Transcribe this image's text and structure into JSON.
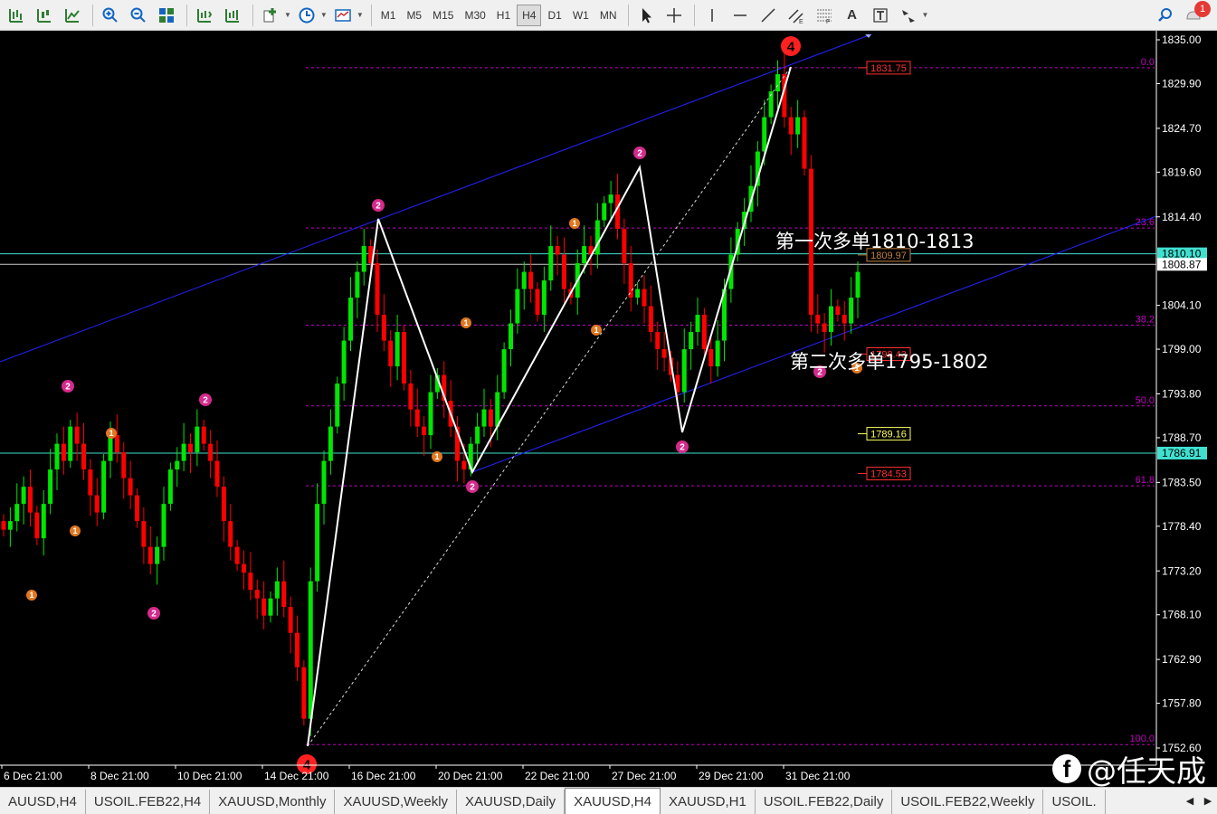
{
  "toolbar": {
    "timeframes": [
      "M1",
      "M5",
      "M15",
      "M30",
      "H1",
      "H4",
      "D1",
      "W1",
      "MN"
    ],
    "active_timeframe": "H4",
    "text_tool_label": "A",
    "notification_count": "1"
  },
  "chart": {
    "symbol": "XAUUSD",
    "timeframe": "H4",
    "price_axis": [
      "1835.00",
      "1829.90",
      "1824.70",
      "1819.60",
      "1814.40",
      "1809.97",
      "1804.10",
      "1799.00",
      "1793.80",
      "1788.70",
      "1783.50",
      "1778.40",
      "1773.20",
      "1768.10",
      "1762.90",
      "1757.80",
      "1752.60"
    ],
    "time_axis": [
      "6 Dec 21:00",
      "8 Dec 21:00",
      "10 Dec 21:00",
      "14 Dec 21:00",
      "16 Dec 21:00",
      "20 Dec 21:00",
      "22 Dec 21:00",
      "27 Dec 21:00",
      "29 Dec 21:00",
      "31 Dec 21:00"
    ],
    "price_badges": {
      "bid": "1810.10",
      "last": "1808.87",
      "hline": "1786.91",
      "level_top": "1831.75",
      "level_mid": "1809.97",
      "level_low": "1798.43",
      "level_yellow": "1789.16",
      "level_bottom": "1784.53"
    },
    "fib_levels": [
      {
        "label": "0.0",
        "price": 1831.75
      },
      {
        "label": "23.6",
        "price": 1813.1
      },
      {
        "label": "38.2",
        "price": 1801.8
      },
      {
        "label": "50.0",
        "price": 1792.4
      },
      {
        "label": "61.8",
        "price": 1783.1
      },
      {
        "label": "100.0",
        "price": 1753.0
      }
    ],
    "annotations": {
      "first_long": "第一次多单1810-1813",
      "second_long": "第二次多单1795-1802"
    },
    "wave_labels": {
      "major_top": "4",
      "major_bottom": "4",
      "minor": "2",
      "sub": "1"
    },
    "colors": {
      "up_candle": "#00e600",
      "down_candle": "#ff0000",
      "channel": "#2323ff",
      "fib": "#c000c0",
      "hline": "#40e0d0",
      "wave": "#ffffff",
      "label2": "#d42a8c",
      "label1": "#e07820",
      "label4": "#ff2020"
    }
  },
  "tabs": {
    "items": [
      "AUUSD,H4",
      "USOIL.FEB22,H4",
      "XAUUSD,Monthly",
      "XAUUSD,Weekly",
      "XAUUSD,Daily",
      "XAUUSD,H4",
      "XAUUSD,H1",
      "USOIL.FEB22,Daily",
      "USOIL.FEB22,Weekly",
      "USOIL."
    ],
    "active_index": 5
  },
  "watermark": {
    "text": "@任天成",
    "logo": "f"
  }
}
